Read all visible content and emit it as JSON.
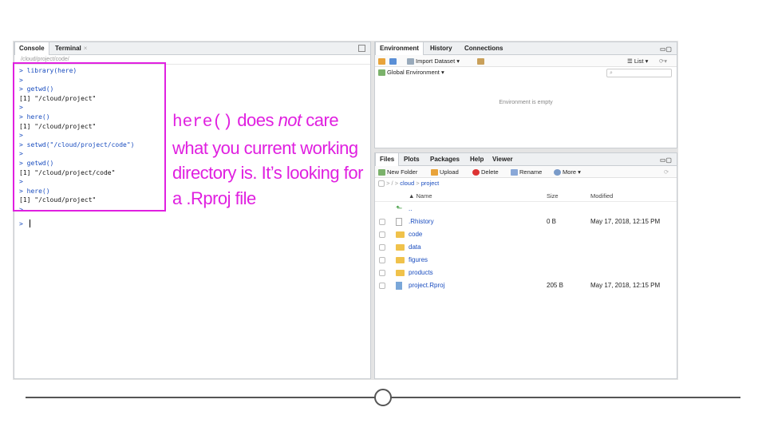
{
  "left_pane": {
    "tabs": [
      "Console",
      "Terminal"
    ],
    "path": "/cloud/project/code/",
    "console_lines": [
      {
        "text": "> library(here)",
        "kind": "cmd"
      },
      {
        "text": ">",
        "kind": "cmd"
      },
      {
        "text": "> getwd()",
        "kind": "cmd"
      },
      {
        "text": "[1] \"/cloud/project\"",
        "kind": "out"
      },
      {
        "text": ">",
        "kind": "cmd"
      },
      {
        "text": "> here()",
        "kind": "cmd"
      },
      {
        "text": "[1] \"/cloud/project\"",
        "kind": "out"
      },
      {
        "text": ">",
        "kind": "cmd"
      },
      {
        "text": "> setwd(\"/cloud/project/code\")",
        "kind": "cmd"
      },
      {
        "text": ">",
        "kind": "cmd"
      },
      {
        "text": "> getwd()",
        "kind": "cmd"
      },
      {
        "text": "[1] \"/cloud/project/code\"",
        "kind": "out"
      },
      {
        "text": ">",
        "kind": "cmd"
      },
      {
        "text": "> here()",
        "kind": "cmd"
      },
      {
        "text": "[1] \"/cloud/project\"",
        "kind": "out"
      },
      {
        "text": ">",
        "kind": "cmd"
      },
      {
        "text": "> ",
        "kind": "cmd"
      }
    ]
  },
  "env_pane": {
    "tabs": [
      "Environment",
      "History",
      "Connections"
    ],
    "import_label": "Import Dataset",
    "list_label": "List",
    "scope_label": "Global Environment",
    "empty_text": "Environment is empty"
  },
  "files_pane": {
    "tabs": [
      "Files",
      "Plots",
      "Packages",
      "Help",
      "Viewer"
    ],
    "toolbar": {
      "new_folder": "New Folder",
      "upload": "Upload",
      "delete": "Delete",
      "rename": "Rename",
      "more": "More"
    },
    "breadcrumb": [
      "cloud",
      "project"
    ],
    "columns": {
      "name": "Name",
      "size": "Size",
      "modified": "Modified"
    },
    "up_label": "..",
    "files": [
      {
        "name": ".Rhistory",
        "type": "file",
        "size": "0 B",
        "modified": "May 17, 2018, 12:15 PM"
      },
      {
        "name": "code",
        "type": "folder",
        "size": "",
        "modified": ""
      },
      {
        "name": "data",
        "type": "folder",
        "size": "",
        "modified": ""
      },
      {
        "name": "figures",
        "type": "folder",
        "size": "",
        "modified": ""
      },
      {
        "name": "products",
        "type": "folder",
        "size": "",
        "modified": ""
      },
      {
        "name": "project.Rproj",
        "type": "rproj",
        "size": "205 B",
        "modified": "May 17, 2018, 12:15 PM"
      }
    ]
  },
  "annotation": {
    "code": "here()",
    "t1": " does ",
    "t_em": "not",
    "t2": " care what you current working directory is. It’s looking for a .Rproj file"
  },
  "colors": {
    "highlight": "#e020e0",
    "command": "#1a4dbf"
  }
}
